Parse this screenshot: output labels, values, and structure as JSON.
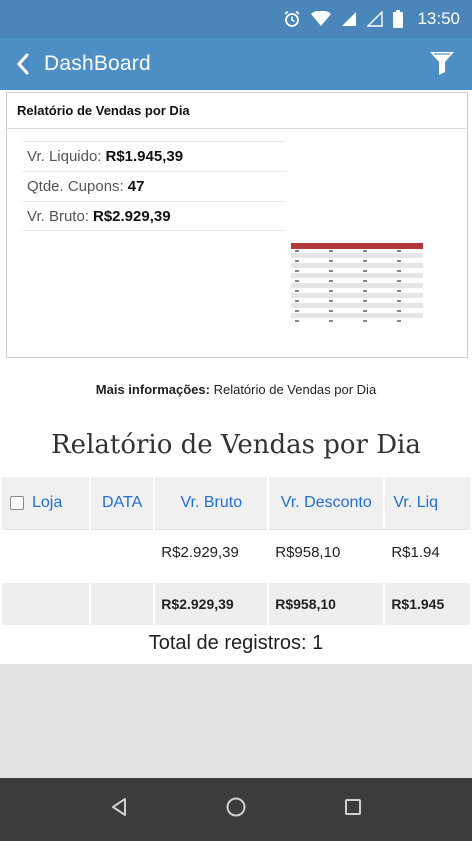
{
  "status_bar": {
    "time": "13:50"
  },
  "app_bar": {
    "back_label": "DashBoard"
  },
  "card": {
    "title": "Relatório de Vendas por Dia",
    "summary": [
      {
        "label": "Vr. Liquido:",
        "value": "R$1.945,39"
      },
      {
        "label": "Qtde. Cupons:",
        "value": "47"
      },
      {
        "label": "Vr. Bruto:",
        "value": "R$2.929,39"
      }
    ]
  },
  "more_info": {
    "label": "Mais informações:",
    "text": "Relatório de Vendas por Dia"
  },
  "report_heading": "Relatório de Vendas por Dia",
  "table": {
    "headers": [
      "Loja",
      "DATA",
      "Vr. Bruto",
      "Vr. Desconto",
      "Vr. Liq"
    ],
    "rows": [
      [
        "",
        "",
        "R$2.929,39",
        "R$958,10",
        "R$1.94"
      ],
      [
        "",
        "",
        "R$2.929,39",
        "R$958,10",
        "R$1.945"
      ]
    ]
  },
  "total_records": "Total de registros: 1",
  "colors": {
    "primary": "#4d8fc4",
    "status_bar": "#4a86b9",
    "link": "#1f6fd6",
    "nav_bar": "#3c3c3c"
  }
}
